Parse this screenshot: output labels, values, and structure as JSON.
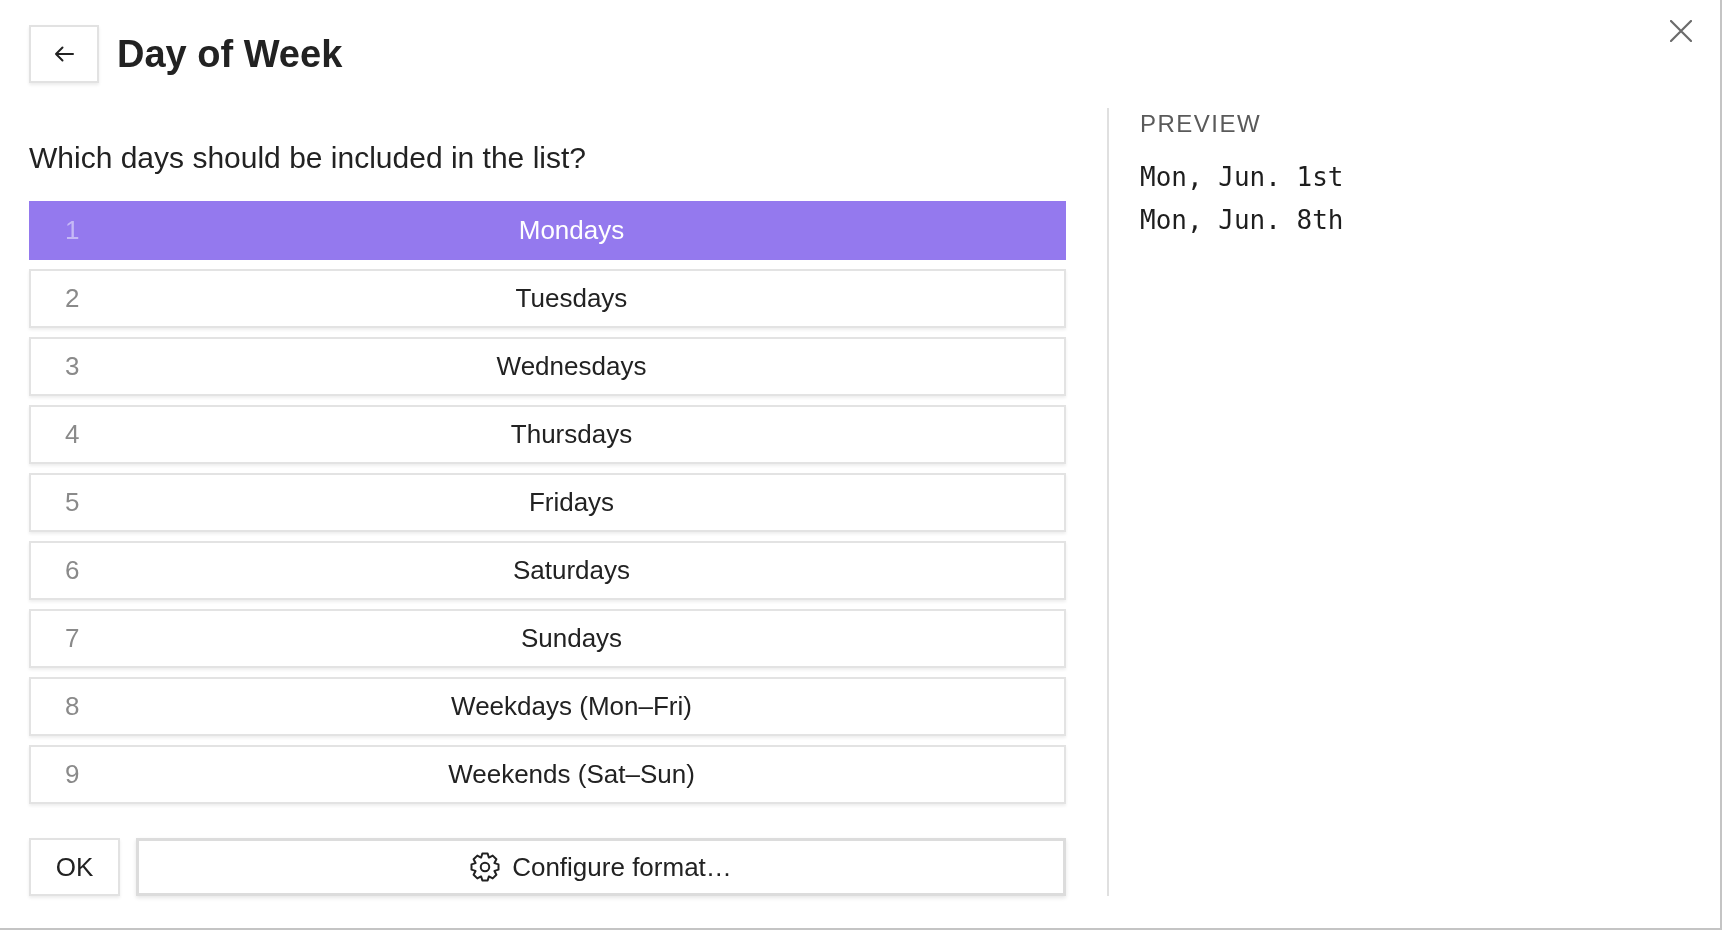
{
  "dialog": {
    "title": "Day of Week"
  },
  "question": "Which days should be included in the list?",
  "options": [
    {
      "number": "1",
      "label": "Mondays",
      "selected": true
    },
    {
      "number": "2",
      "label": "Tuesdays",
      "selected": false
    },
    {
      "number": "3",
      "label": "Wednesdays",
      "selected": false
    },
    {
      "number": "4",
      "label": "Thursdays",
      "selected": false
    },
    {
      "number": "5",
      "label": "Fridays",
      "selected": false
    },
    {
      "number": "6",
      "label": "Saturdays",
      "selected": false
    },
    {
      "number": "7",
      "label": "Sundays",
      "selected": false
    },
    {
      "number": "8",
      "label": "Weekdays (Mon–Fri)",
      "selected": false
    },
    {
      "number": "9",
      "label": "Weekends (Sat–Sun)",
      "selected": false
    }
  ],
  "actions": [
    {
      "kind": "ok",
      "label": "OK"
    },
    {
      "kind": "configure",
      "label": "Configure format…"
    }
  ],
  "preview": {
    "heading": "PREVIEW",
    "lines": [
      "Mon, Jun. 1st",
      "Mon, Jun. 8th"
    ]
  }
}
